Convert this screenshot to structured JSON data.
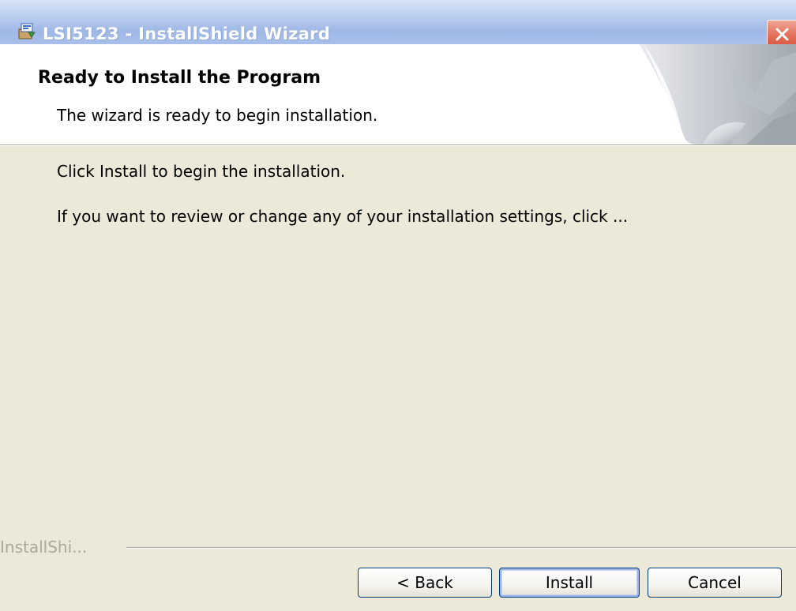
{
  "window": {
    "title": "LSI5123 - InstallShield Wizard",
    "icon": "installer-package-icon",
    "close_icon": "close-icon"
  },
  "banner": {
    "title": "Ready to Install the Program",
    "subtitle": "The wizard is ready to begin installation.",
    "graphic": "page-curl-graphic"
  },
  "body": {
    "line1": "Click Install to begin the installation.",
    "line2": "If you want to review or change any of your installation settings, click ..."
  },
  "footer": {
    "label": "InstallShi..."
  },
  "buttons": {
    "back": "< Back",
    "install": "Install",
    "cancel": "Cancel"
  },
  "colors": {
    "dialog_background": "#ece9d8",
    "title_bar": "#a9bfe9",
    "close_button": "#e4735f",
    "button_border": "#003c74",
    "disabled_text": "#aca899"
  }
}
